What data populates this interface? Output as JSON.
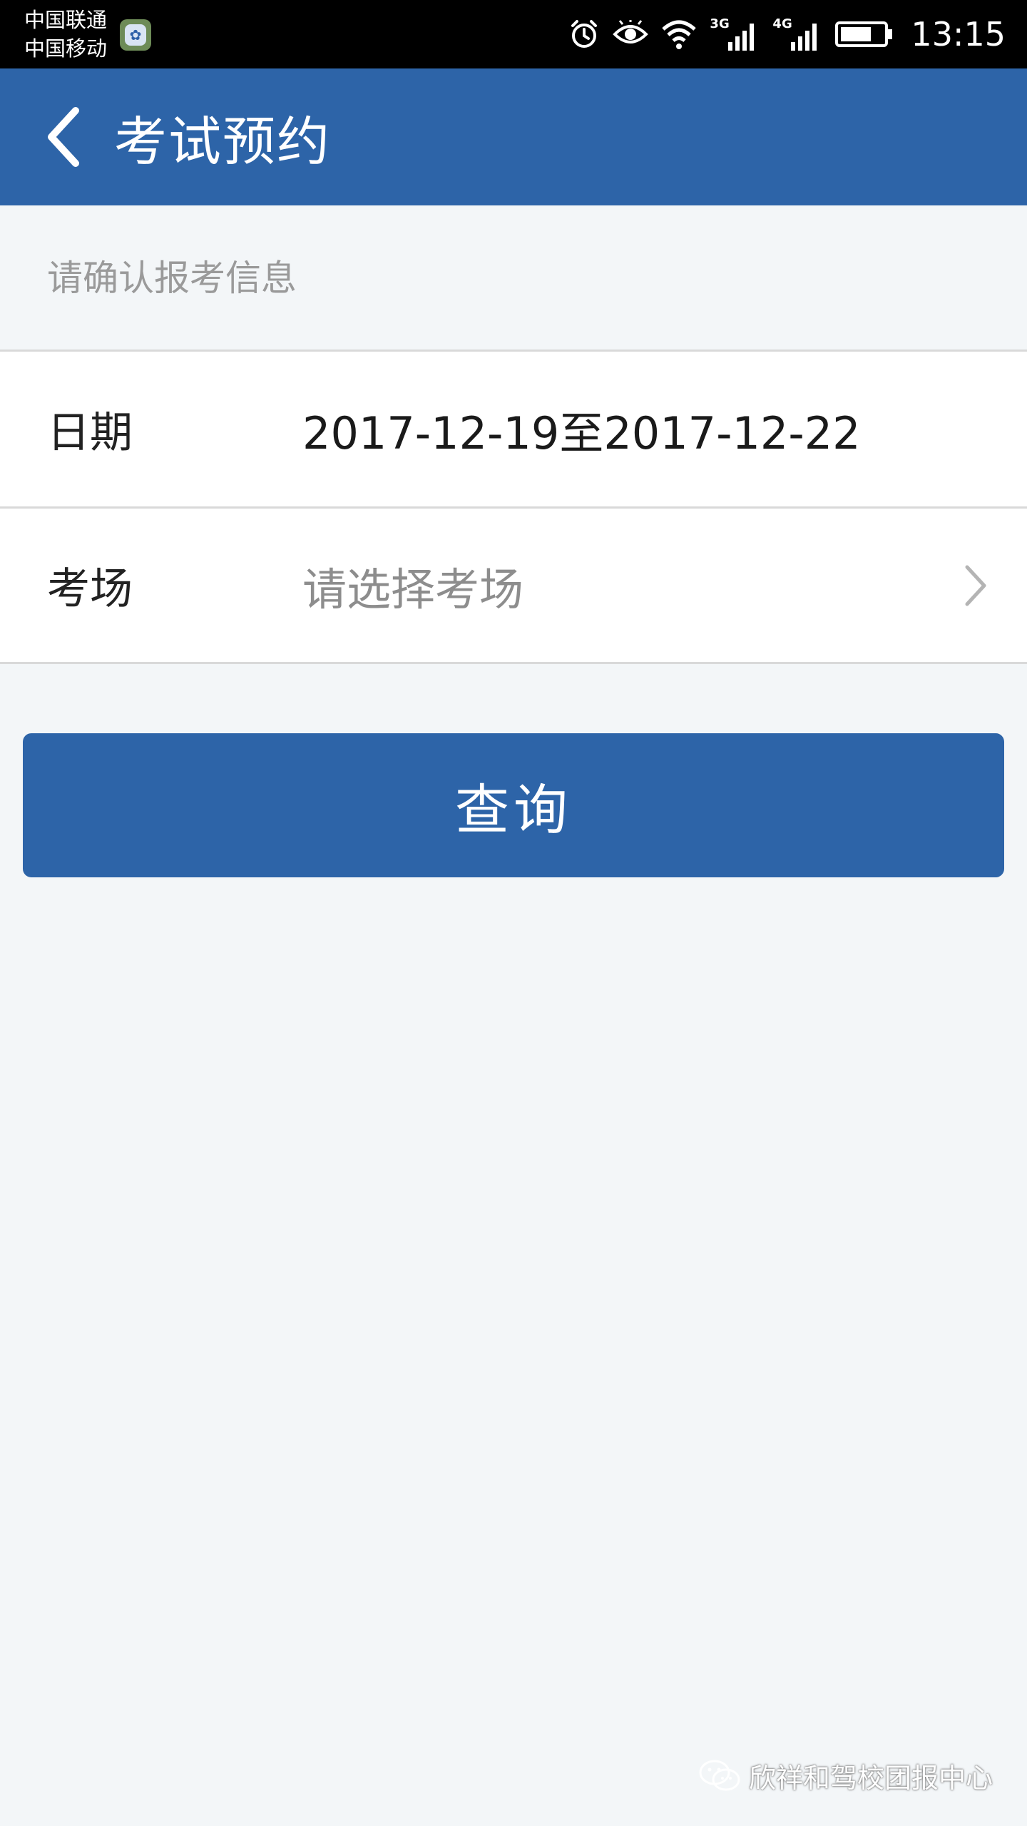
{
  "status_bar": {
    "carrier_1": "中国联通",
    "carrier_2": "中国移动",
    "network_1": "3G",
    "network_2": "4G",
    "time": "13:15",
    "icons": [
      "app-notification-icon",
      "alarm-icon",
      "eye-icon",
      "wifi-icon",
      "signal-3g-icon",
      "signal-4g-icon",
      "battery-icon"
    ]
  },
  "app_bar": {
    "title": "考试预约",
    "back_icon": "chevron-left-icon",
    "color": "#2d64a8"
  },
  "form": {
    "hint": "请确认报考信息",
    "date_label": "日期",
    "date_value": "2017-12-19至2017-12-22",
    "venue_label": "考场",
    "venue_placeholder": "请选择考场",
    "venue_icon": "chevron-right-icon"
  },
  "query_button": {
    "label": "查询"
  },
  "watermark": {
    "text": "欣祥和驾校团报中心",
    "icon": "wechat-icon"
  }
}
